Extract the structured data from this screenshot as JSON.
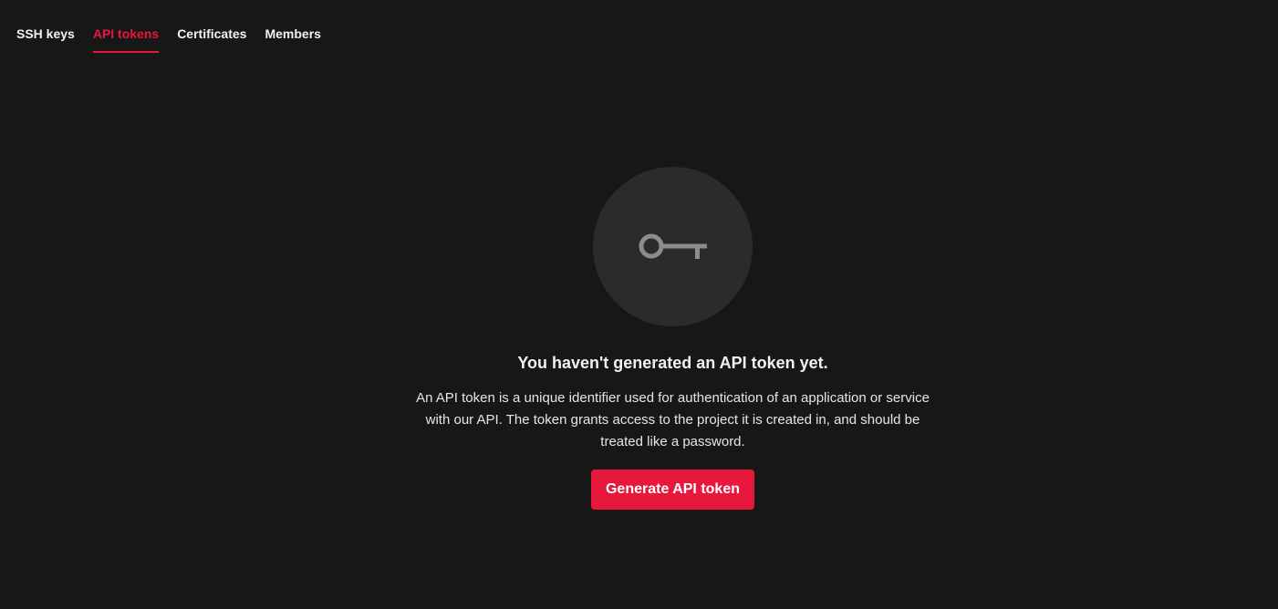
{
  "tabs": [
    {
      "label": "SSH keys",
      "active": false
    },
    {
      "label": "API tokens",
      "active": true
    },
    {
      "label": "Certificates",
      "active": false
    },
    {
      "label": "Members",
      "active": false
    }
  ],
  "empty_state": {
    "icon": "key-icon",
    "title": "You haven't generated an API token yet.",
    "description": "An API token is a unique identifier used for authentication of an application or service with our API. The token grants access to the project it is created in, and should be treated like a password.",
    "button_label": "Generate API token"
  },
  "colors": {
    "background": "#171717",
    "accent": "#e8173c",
    "icon_circle": "#2b2b2b",
    "icon": "#8c8c8c",
    "text": "#f2f2f2"
  }
}
